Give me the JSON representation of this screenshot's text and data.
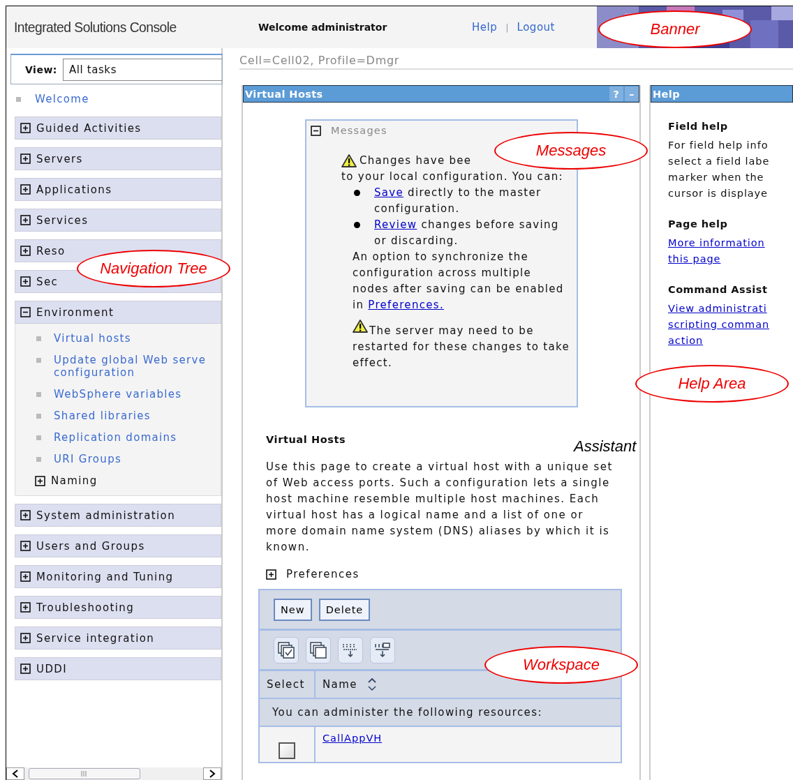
{
  "header": {
    "title": "Integrated Solutions Console",
    "welcome": "Welcome administrator",
    "links": [
      "Help",
      "Logout"
    ],
    "separator": "|"
  },
  "nav": {
    "view_label": "View:",
    "view_value": "All tasks",
    "welcome": "Welcome",
    "groups": [
      {
        "label": "Guided Activities",
        "expanded": false
      },
      {
        "label": "Servers",
        "expanded": false
      },
      {
        "label": "Applications",
        "expanded": false
      },
      {
        "label": "Services",
        "expanded": false
      },
      {
        "label": "Reso",
        "expanded": false
      },
      {
        "label": "Sec",
        "expanded": false
      },
      {
        "label": "Environment",
        "expanded": true,
        "children": [
          {
            "kind": "link",
            "label": "Virtual hosts"
          },
          {
            "kind": "link",
            "label": "Update global Web serve",
            "label_2": "configuration"
          },
          {
            "kind": "link",
            "label": "WebSphere variables"
          },
          {
            "kind": "link",
            "label": "Shared libraries"
          },
          {
            "kind": "link",
            "label": "Replication domains"
          },
          {
            "kind": "link",
            "label": "URI Groups"
          },
          {
            "kind": "group",
            "label": "Naming",
            "expanded": false
          }
        ]
      },
      {
        "label": "System administration",
        "expanded": false
      },
      {
        "label": "Users and Groups",
        "expanded": false
      },
      {
        "label": "Monitoring and Tuning",
        "expanded": false
      },
      {
        "label": "Troubleshooting",
        "expanded": false
      },
      {
        "label": "Service integration",
        "expanded": false
      },
      {
        "label": "UDDI",
        "expanded": false
      }
    ]
  },
  "breadcrumb": "Cell=Cell02, Profile=Dmgr",
  "workspace": {
    "title": "Virtual Hosts",
    "header_buttons": [
      "?",
      "–"
    ],
    "messages": {
      "title": "Messages",
      "expanded": true,
      "warning_1": "Changes have bee",
      "warning_1_rest": "to your local configuration. You can:",
      "bullets": [
        {
          "link": "Save",
          "text": "directly to the master configuration."
        },
        {
          "link": "Review",
          "text": "changes before saving or discarding."
        }
      ],
      "option": "An option to synchronize the configuration across multiple nodes after saving can be enabled in",
      "option_link": "Preferences.",
      "warning_2": "The server may need to be restarted for these changes to take effect."
    },
    "heading": "Virtual Hosts",
    "description": "Use this page to create a virtual host with a unique set of Web access ports. Such a configuration lets a single host machine resemble multiple host machines. Each virtual host has a logical name and a list of one or more domain name system (DNS) aliases by which it is known.",
    "preferences": {
      "label": "Preferences",
      "expanded": false
    },
    "table": {
      "buttons": [
        "New",
        "Delete"
      ],
      "columns": [
        "Select",
        "Name"
      ],
      "info": "You can administer the following resources:",
      "rows": [
        {
          "name": "CallAppVH",
          "checked": false
        }
      ]
    }
  },
  "help": {
    "title": "Help",
    "sections": [
      {
        "kind": "text",
        "title": "Field help",
        "lines": [
          "For field help info",
          "select a field labe",
          "marker when the",
          "cursor is displaye"
        ]
      },
      {
        "kind": "links",
        "title": "Page help",
        "lines": [
          "More information",
          "this page"
        ]
      },
      {
        "kind": "links",
        "title": "Command Assist",
        "lines": [
          "View administrati",
          "scripting comman",
          "action"
        ]
      }
    ]
  },
  "annotations": [
    {
      "kind": "ellipse",
      "label": "Banner"
    },
    {
      "kind": "ellipse",
      "label": "Messages"
    },
    {
      "kind": "ellipse",
      "label": "Navigation Tree"
    },
    {
      "kind": "ellipse",
      "label": "Help Area"
    },
    {
      "kind": "ellipse",
      "label": "Workspace"
    },
    {
      "kind": "plain",
      "label": "Assistant"
    }
  ]
}
